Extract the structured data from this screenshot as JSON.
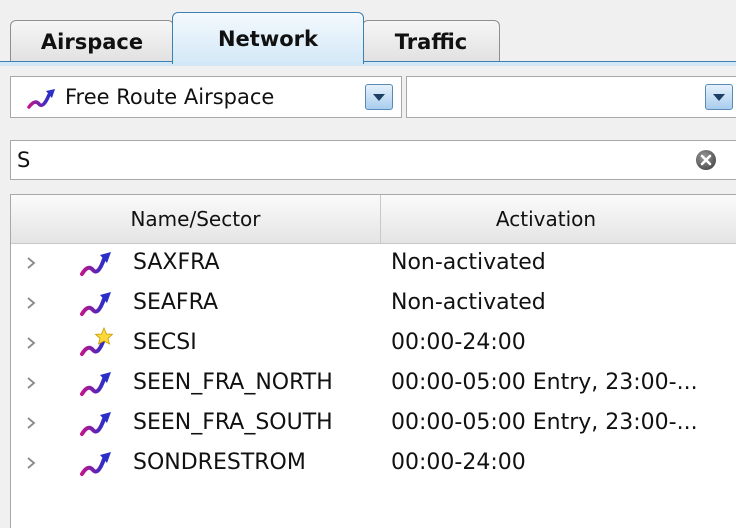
{
  "tabs": [
    {
      "label": "Airspace",
      "active": false
    },
    {
      "label": "Network",
      "active": true
    },
    {
      "label": "Traffic",
      "active": false
    }
  ],
  "filter": {
    "type_value": "Free Route Airspace",
    "type_icon": "route-icon",
    "secondary_value": ""
  },
  "search": {
    "value": "S",
    "clear_icon": "clear-icon"
  },
  "table": {
    "columns": [
      "Name/Sector",
      "Activation"
    ],
    "rows": [
      {
        "name": "SAXFRA",
        "activation": "Non-activated",
        "icon": "route-icon"
      },
      {
        "name": "SEAFRA",
        "activation": "Non-activated",
        "icon": "route-icon"
      },
      {
        "name": "SECSI",
        "activation": "00:00-24:00",
        "icon": "route-star-icon"
      },
      {
        "name": "SEEN_FRA_NORTH",
        "activation": "00:00-05:00 Entry, 23:00-...",
        "icon": "route-icon"
      },
      {
        "name": "SEEN_FRA_SOUTH",
        "activation": "00:00-05:00 Entry, 23:00-...",
        "icon": "route-icon"
      },
      {
        "name": "SONDRESTROM",
        "activation": "00:00-24:00",
        "icon": "route-icon"
      }
    ]
  },
  "colors": {
    "active_tab": "#d3e8f7",
    "accent_border": "#3c7fb1",
    "route_icon_start": "#c0148c",
    "route_icon_end": "#2b2fc8"
  }
}
